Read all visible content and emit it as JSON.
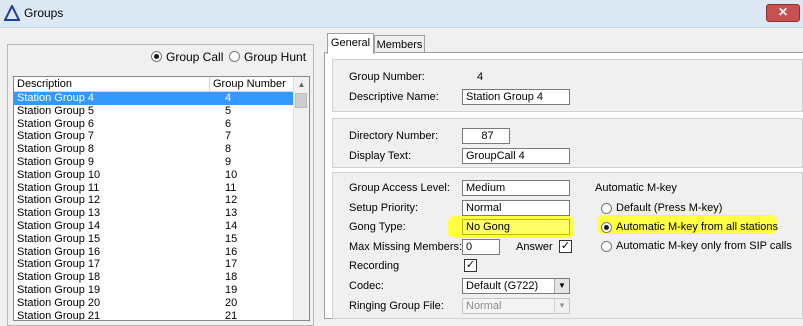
{
  "window": {
    "title": "Groups",
    "close_glyph": "✕"
  },
  "group_type": {
    "options": [
      {
        "label": "Group Call",
        "selected": true
      },
      {
        "label": "Group Hunt",
        "selected": false
      }
    ]
  },
  "list": {
    "columns": [
      "Description",
      "Group Number"
    ],
    "rows": [
      {
        "description": "Station Group 4",
        "number": "4",
        "selected": true
      },
      {
        "description": "Station Group 5",
        "number": "5"
      },
      {
        "description": "Station Group 6",
        "number": "6"
      },
      {
        "description": "Station Group 7",
        "number": "7"
      },
      {
        "description": "Station Group 8",
        "number": "8"
      },
      {
        "description": "Station Group 9",
        "number": "9"
      },
      {
        "description": "Station Group 10",
        "number": "10"
      },
      {
        "description": "Station Group 11",
        "number": "11"
      },
      {
        "description": "Station Group 12",
        "number": "12"
      },
      {
        "description": "Station Group 13",
        "number": "13"
      },
      {
        "description": "Station Group 14",
        "number": "14"
      },
      {
        "description": "Station Group 15",
        "number": "15"
      },
      {
        "description": "Station Group 16",
        "number": "16"
      },
      {
        "description": "Station Group 17",
        "number": "17"
      },
      {
        "description": "Station Group 18",
        "number": "18"
      },
      {
        "description": "Station Group 19",
        "number": "19"
      },
      {
        "description": "Station Group 20",
        "number": "20"
      },
      {
        "description": "Station Group 21",
        "number": "21"
      }
    ]
  },
  "tabs": [
    {
      "label": "General",
      "active": true
    },
    {
      "label": "Members",
      "active": false
    }
  ],
  "general": {
    "group_number_label": "Group Number:",
    "group_number_value": "4",
    "descriptive_name_label": "Descriptive Name:",
    "descriptive_name_value": "Station Group 4",
    "directory_number_label": "Directory Number:",
    "directory_number_value": "87",
    "display_text_label": "Display Text:",
    "display_text_value": "GroupCall 4",
    "group_access_level_label": "Group Access Level:",
    "group_access_level_value": "Medium",
    "setup_priority_label": "Setup Priority:",
    "setup_priority_value": "Normal",
    "gong_type_label": "Gong Type:",
    "gong_type_value": "No Gong",
    "max_missing_members_label": "Max Missing Members:",
    "max_missing_members_value": "0",
    "answer_label": "Answer",
    "answer_checked": true,
    "recording_label": "Recording",
    "recording_checked": true,
    "codec_label": "Codec:",
    "codec_value": "Default (G722)",
    "ringing_group_file_label": "Ringing Group File:",
    "ringing_group_file_value": "Normal"
  },
  "mkey": {
    "title": "Automatic M-key",
    "options": [
      {
        "label": "Default (Press M-key)",
        "selected": false
      },
      {
        "label": "Automatic M-key from all stations",
        "selected": true
      },
      {
        "label": "Automatic M-key only from SIP calls",
        "selected": false
      }
    ]
  },
  "colors": {
    "highlight": "#ffff44",
    "selection": "#3399ff",
    "close": "#c75050"
  }
}
